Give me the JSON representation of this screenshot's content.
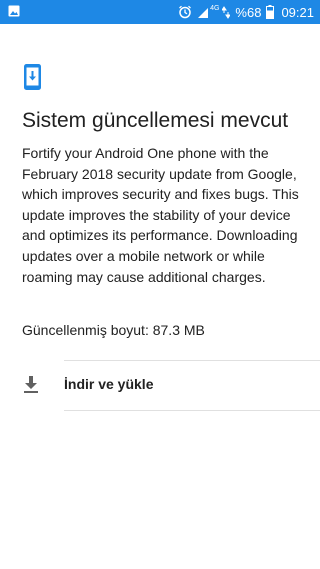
{
  "status_bar": {
    "left_icon": "image-icon",
    "alarm_icon": "alarm-icon",
    "network_type": "4G",
    "battery": "%68",
    "time": "09:21",
    "color": "#1e88e5"
  },
  "main": {
    "icon": "system-update-icon",
    "title": "Sistem güncellemesi mevcut",
    "description": "Fortify your Android One phone with the February 2018 security update from Google, which improves security and fixes bugs. This update improves the stability of your device and optimizes its performance. Downloading updates over a mobile network or while roaming may cause additional charges.",
    "size": "Güncellenmiş boyut: 87.3 MB"
  },
  "action": {
    "icon": "download-icon",
    "label": "İndir ve yükle"
  }
}
